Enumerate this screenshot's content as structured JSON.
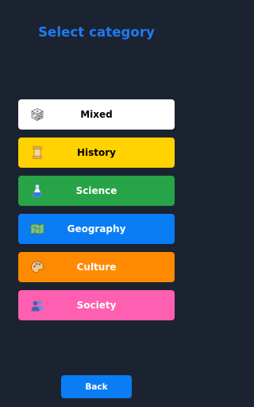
{
  "header": {
    "title": "Select category"
  },
  "categories": [
    {
      "label": "Mixed",
      "icon": "dice-icon",
      "bg": "#ffffff",
      "fg": "#000000"
    },
    {
      "label": "History",
      "icon": "scroll-icon",
      "bg": "#ffd200",
      "fg": "#000000"
    },
    {
      "label": "Science",
      "icon": "flask-icon",
      "bg": "#27a348",
      "fg": "#ffffff"
    },
    {
      "label": "Geography",
      "icon": "map-icon",
      "bg": "#0a7df5",
      "fg": "#ffffff"
    },
    {
      "label": "Culture",
      "icon": "palette-icon",
      "bg": "#ff8a00",
      "fg": "#ffffff"
    },
    {
      "label": "Society",
      "icon": "people-icon",
      "bg": "#ff5fb0",
      "fg": "#ffffff"
    }
  ],
  "footer": {
    "back_label": "Back"
  },
  "colors": {
    "background": "#1b2330",
    "title": "#1e7bf2",
    "back_button": "#0a7df5"
  }
}
